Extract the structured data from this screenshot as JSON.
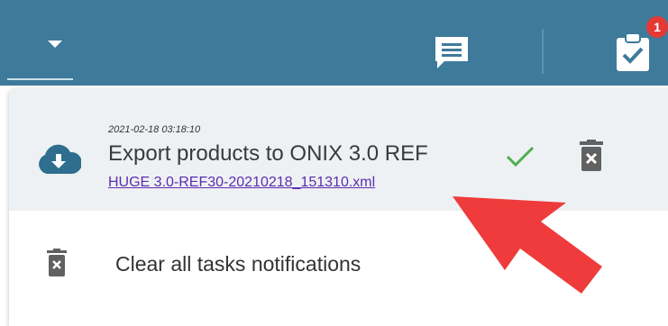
{
  "header": {
    "badge_count": "1",
    "icons": [
      "chevron-down-icon",
      "chat-icon",
      "clipboard-check-icon"
    ]
  },
  "task": {
    "timestamp": "2021-02-18 03:18:10",
    "title": "Export products to ONIX 3.0 REF",
    "file_link": "HUGE 3.0-REF30-20210218_151310.xml",
    "status": "done",
    "icons": [
      "cloud-download-icon",
      "check-icon",
      "trash-icon"
    ]
  },
  "actions": {
    "clear_all_label": "Clear all tasks notifications"
  },
  "colors": {
    "topbar": "#3e7a9a",
    "success": "#4caf50",
    "badge": "#e53935",
    "link": "#5b2db0",
    "annotation_arrow": "#ef3b3b"
  }
}
